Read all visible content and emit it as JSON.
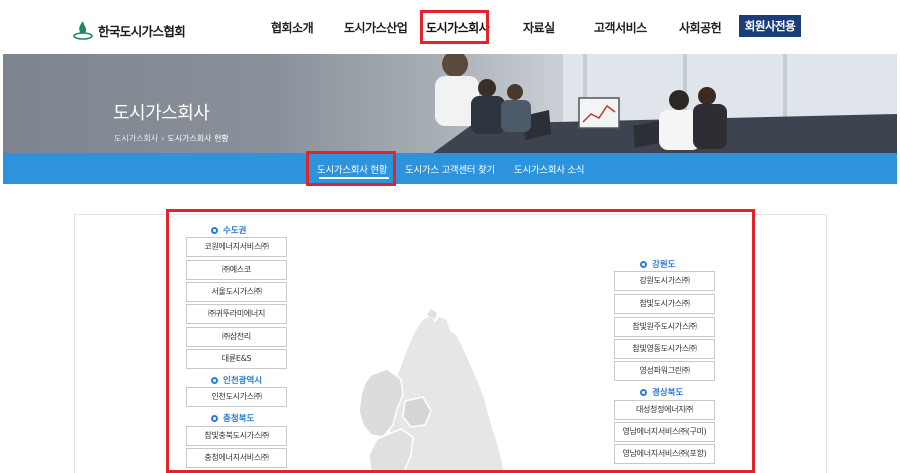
{
  "header": {
    "logo_text": "한국도시가스협회",
    "nav": [
      "협회소개",
      "도시가스산업",
      "도시가스회사",
      "자료실",
      "고객서비스",
      "사회공헌"
    ],
    "active_nav_index": 2,
    "member_button": "회원사전용"
  },
  "banner": {
    "title": "도시가스회사",
    "breadcrumb": [
      "도시가스회사",
      "도시가스회사 현황"
    ]
  },
  "subnav": {
    "items": [
      "도시가스회사 현황",
      "도시가스 고객센터 찾기",
      "도시가스회사 소식"
    ],
    "active_index": 0
  },
  "map": {
    "left_regions": [
      {
        "name": "수도권",
        "companies": [
          "코원에너지서비스㈜",
          "㈜예스코",
          "서울도시가스㈜",
          "㈜귀뚜라미에너지",
          "㈜삼천리",
          "대륜E&S"
        ]
      },
      {
        "name": "인천광역시",
        "companies": [
          "인천도시가스㈜"
        ]
      },
      {
        "name": "충청북도",
        "companies": [
          "참빛충북도시가스㈜",
          "충청에너지서비스㈜"
        ]
      }
    ],
    "right_regions": [
      {
        "name": "강원도",
        "companies": [
          "강원도시가스㈜",
          "참빛도시가스㈜",
          "참빛원주도시가스㈜",
          "참빛영동도시가스㈜",
          "영성파워그린㈜"
        ]
      },
      {
        "name": "경상북도",
        "companies": [
          "대성청정에너지㈜",
          "영남에너지서비스㈜(구미)",
          "영남에너지서비스㈜(포항)"
        ]
      }
    ]
  },
  "colors": {
    "brand_navy": "#1d3d7a",
    "subnav_blue": "#2d93dc",
    "region_blue": "#2d7ad6",
    "highlight_red": "#e1242b"
  }
}
